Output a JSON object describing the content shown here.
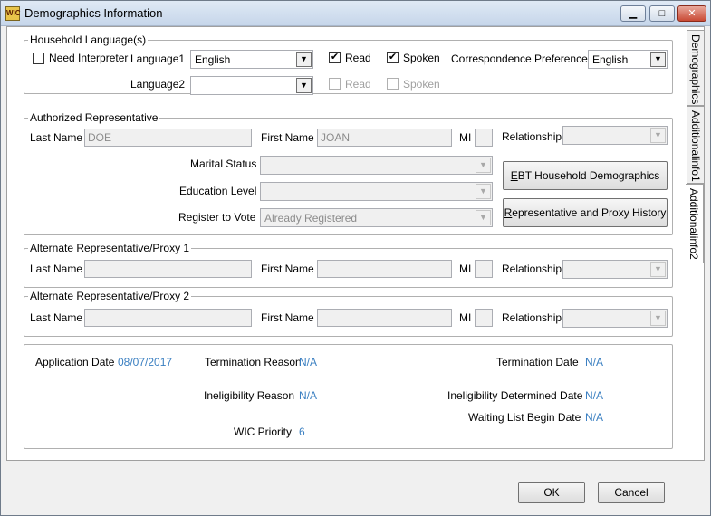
{
  "window": {
    "title": "Demographics Information",
    "icon_text": "WIC"
  },
  "tabs": [
    "Demographics",
    "Additionalinfo1",
    "Additionalinfo2"
  ],
  "household": {
    "legend": "Household Language(s)",
    "need_interpreter": "Need Interpreter",
    "language1_label": "Language1",
    "language1_value": "English",
    "language2_label": "Language2",
    "language2_value": "",
    "read": "Read",
    "spoken": "Spoken",
    "corr_pref_label": "Correspondence Preference",
    "corr_pref_value": "English"
  },
  "auth_rep": {
    "legend": "Authorized Representative",
    "last_name_label": "Last Name",
    "last_name_value": "DOE",
    "first_name_label": "First Name",
    "first_name_value": "JOAN",
    "mi_label": "MI",
    "relationship_label": "Relationship",
    "marital_label": "Marital Status",
    "education_label": "Education Level",
    "vote_label": "Register to Vote",
    "vote_value": "Already Registered",
    "ebt_button_pre": "",
    "ebt_button_key": "E",
    "ebt_button_post": "BT Household Demographics",
    "history_button_key": "R",
    "history_button_post": "epresentative and Proxy History"
  },
  "alt1": {
    "legend": "Alternate Representative/Proxy 1",
    "last_name_label": "Last Name",
    "first_name_label": "First Name",
    "mi_label": "MI",
    "relationship_label": "Relationship"
  },
  "alt2": {
    "legend": "Alternate Representative/Proxy 2",
    "last_name_label": "Last Name",
    "first_name_label": "First Name",
    "mi_label": "MI",
    "relationship_label": "Relationship"
  },
  "info": {
    "app_date_label": "Application Date",
    "app_date_value": "08/07/2017",
    "term_reason_label": "Termination Reason",
    "term_reason_value": "N/A",
    "term_date_label": "Termination Date",
    "term_date_value": "N/A",
    "inelig_reason_label": "Ineligibility Reason",
    "inelig_reason_value": "N/A",
    "inelig_date_label": "Ineligibility Determined Date",
    "inelig_date_value": "N/A",
    "waiting_label": "Waiting List Begin Date",
    "waiting_value": "N/A",
    "wic_priority_label": "WIC Priority",
    "wic_priority_value": "6"
  },
  "footer": {
    "ok": "OK",
    "cancel": "Cancel"
  },
  "icons": {
    "checked": "✔",
    "dropdown": "▼",
    "minimize": "▁",
    "maximize": "□",
    "close": "✕"
  },
  "colors": {
    "value_text": "#3a7fc1",
    "title_gradient": "#c6d6ea"
  }
}
